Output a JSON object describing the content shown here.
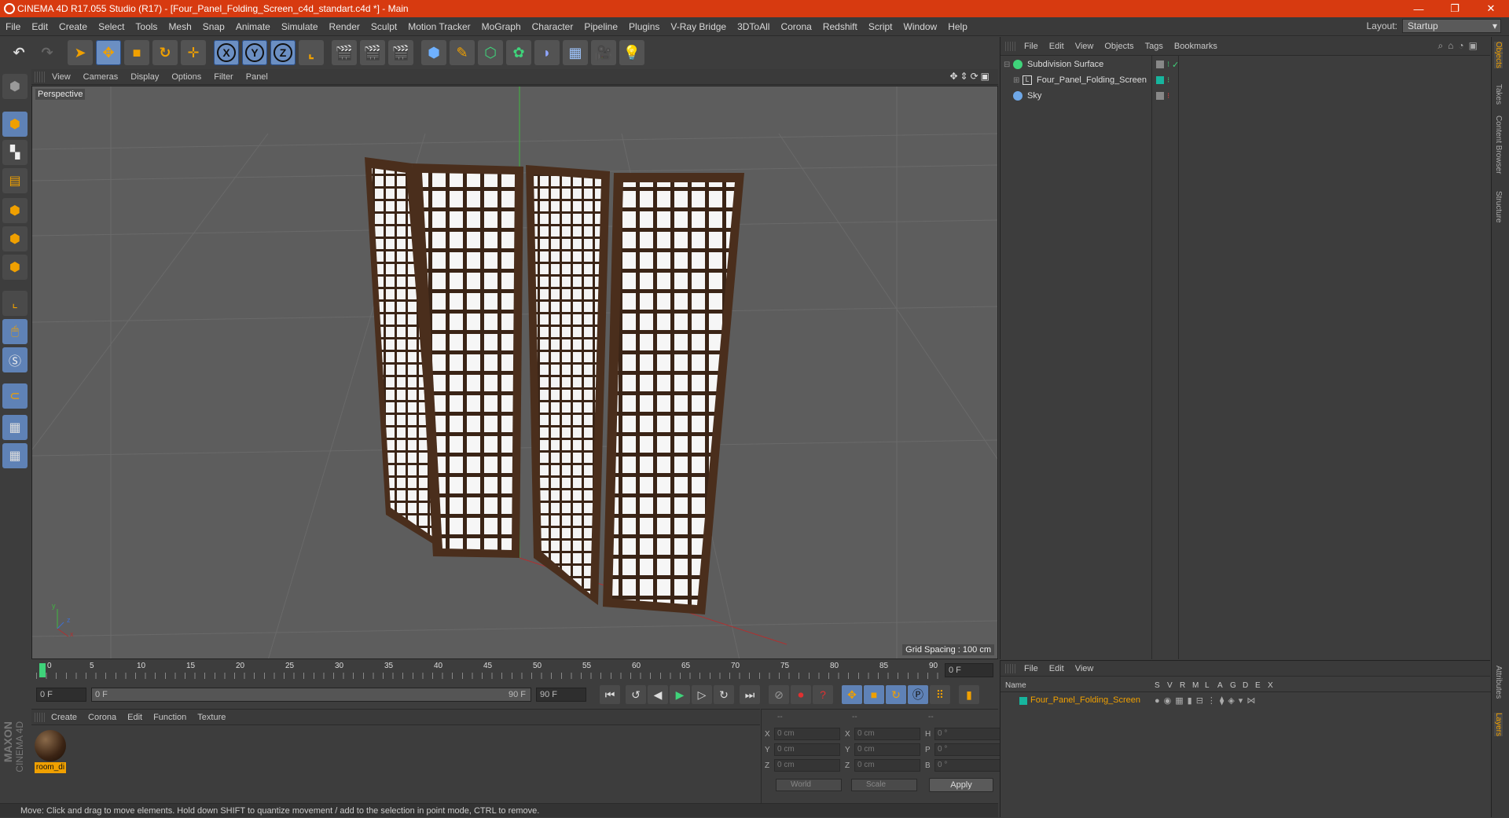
{
  "window": {
    "title": "CINEMA 4D R17.055 Studio (R17) - [Four_Panel_Folding_Screen_c4d_standart.c4d *] - Main",
    "minimize": "—",
    "restore": "❐",
    "close": "✕"
  },
  "menubar": {
    "items": [
      "File",
      "Edit",
      "Create",
      "Select",
      "Tools",
      "Mesh",
      "Snap",
      "Animate",
      "Simulate",
      "Render",
      "Sculpt",
      "Motion Tracker",
      "MoGraph",
      "Character",
      "Pipeline",
      "Plugins",
      "V-Ray Bridge",
      "3DToAll",
      "Corona",
      "Redshift",
      "Script",
      "Window",
      "Help"
    ],
    "layout_label": "Layout:",
    "layout_value": "Startup"
  },
  "toolbar": {
    "axis_x": "X",
    "axis_y": "Y",
    "axis_z": "Z"
  },
  "viewport": {
    "menu": [
      "View",
      "Cameras",
      "Display",
      "Options",
      "Filter",
      "Panel"
    ],
    "camera_label": "Perspective",
    "grid_spacing": "Grid Spacing : 100 cm",
    "axis_y": "y",
    "axis_z": "z",
    "axis_x": "x"
  },
  "timeline": {
    "ticks": [
      "0",
      "5",
      "10",
      "15",
      "20",
      "25",
      "30",
      "35",
      "40",
      "45",
      "50",
      "55",
      "60",
      "65",
      "70",
      "75",
      "80",
      "85",
      "90"
    ],
    "current_frame": "0 F"
  },
  "transport": {
    "start_frame": "0 F",
    "range_start": "0 F",
    "range_end": "90 F",
    "end_frame": "90 F"
  },
  "material_panel": {
    "menu": [
      "Create",
      "Corona",
      "Edit",
      "Function",
      "Texture"
    ],
    "material_name": "room_di"
  },
  "coords": {
    "headers": [
      "--",
      "--",
      "--"
    ],
    "rows": [
      {
        "a": "X",
        "av": "0 cm",
        "b": "X",
        "bv": "0 cm",
        "c": "H",
        "cv": "0 °"
      },
      {
        "a": "Y",
        "av": "0 cm",
        "b": "Y",
        "bv": "0 cm",
        "c": "P",
        "cv": "0 °"
      },
      {
        "a": "Z",
        "av": "0 cm",
        "b": "Z",
        "bv": "0 cm",
        "c": "B",
        "cv": "0 °"
      }
    ],
    "world": "World",
    "scale": "Scale",
    "apply": "Apply"
  },
  "status": {
    "text": "Move: Click and drag to move elements. Hold down SHIFT to quantize movement / add to the selection in point mode, CTRL to remove."
  },
  "brand": {
    "line1": "MAXON",
    "line2": "CINEMA 4D"
  },
  "object_manager": {
    "menu": [
      "File",
      "Edit",
      "View",
      "Objects",
      "Tags",
      "Bookmarks"
    ],
    "objects": [
      {
        "name": "Subdivision Surface"
      },
      {
        "name": "Four_Panel_Folding_Screen"
      },
      {
        "name": "Sky"
      }
    ]
  },
  "layer_manager": {
    "menu": [
      "File",
      "Edit",
      "View"
    ],
    "columns": [
      "Name",
      "S",
      "V",
      "R",
      "M",
      "L",
      "A",
      "G",
      "D",
      "E",
      "X"
    ],
    "layer_name": "Four_Panel_Folding_Screen"
  },
  "right_tabs": {
    "objects": "Objects",
    "takes": "Takes",
    "content_browser": "Content Browser",
    "structure": "Structure",
    "attributes": "Attributes",
    "layers": "Layers"
  },
  "colors": {
    "titlebar": "#d73a10",
    "accent_blue": "#5f82b6",
    "layer_orange": "#f0a000",
    "layer_teal": "#17b59e",
    "frame_brown": "#5a3a24"
  }
}
